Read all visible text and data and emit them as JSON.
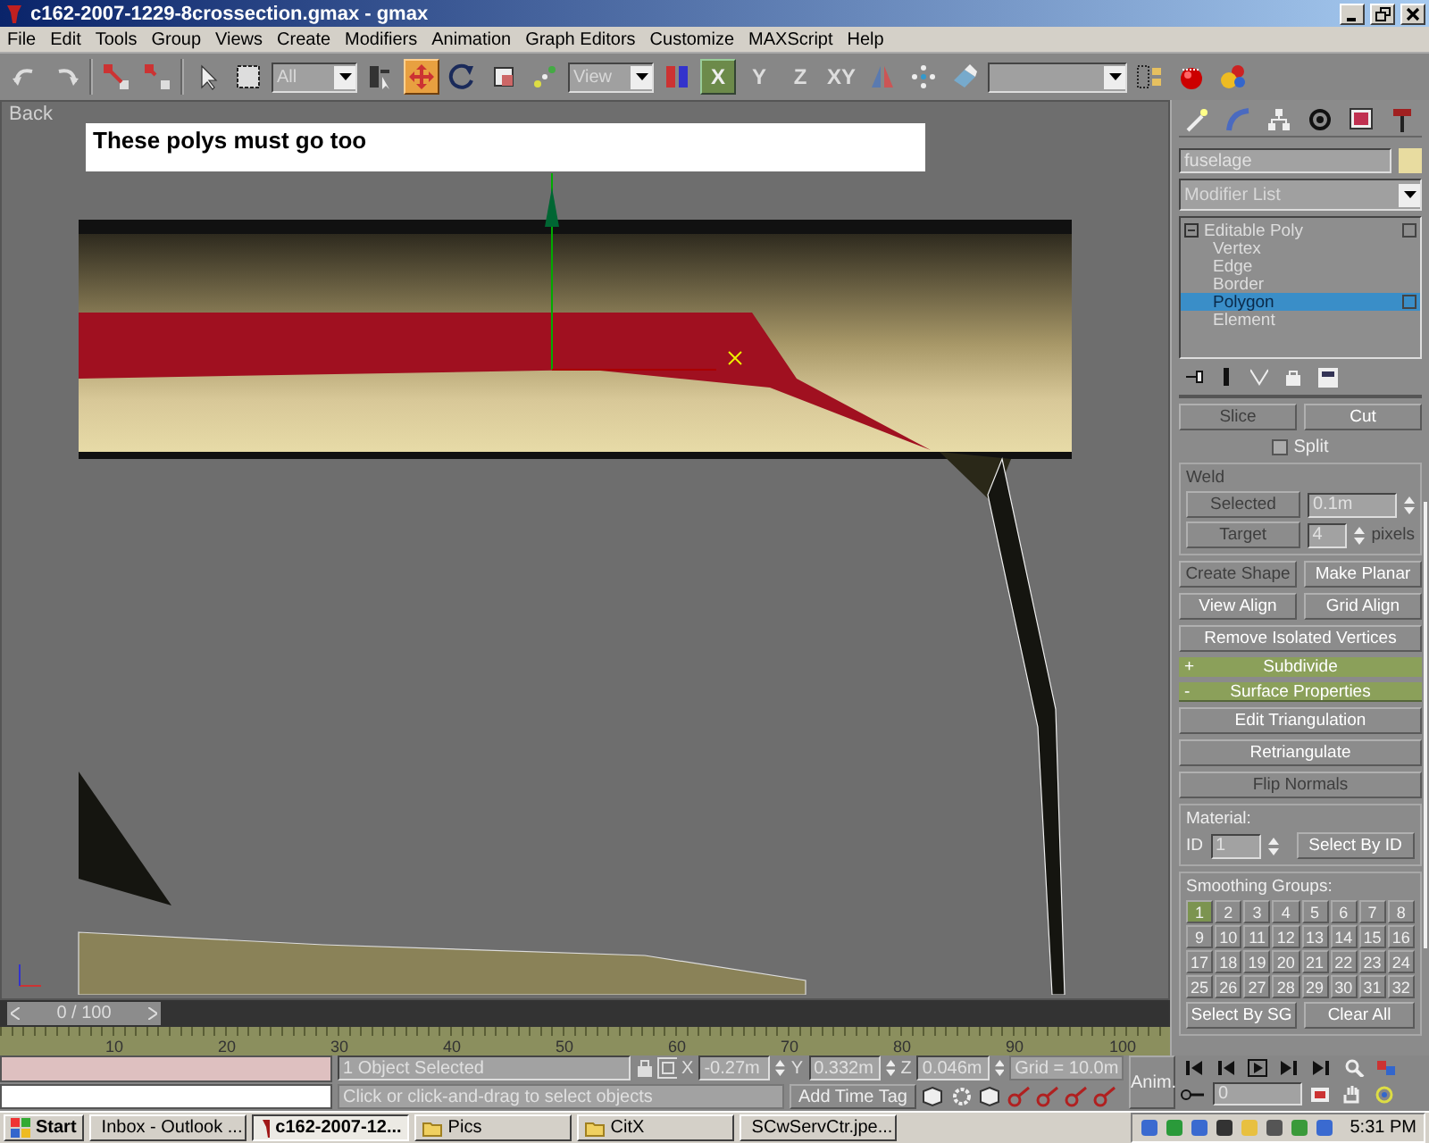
{
  "window": {
    "title": "c162-2007-1229-8crossection.gmax - gmax"
  },
  "menu": [
    "File",
    "Edit",
    "Tools",
    "Group",
    "Views",
    "Create",
    "Modifiers",
    "Animation",
    "Graph Editors",
    "Customize",
    "MAXScript",
    "Help"
  ],
  "toolbar": [
    {
      "kind": "undo",
      "selected": false
    },
    {
      "kind": "redo",
      "selected": false
    },
    {
      "kind": "sep"
    },
    {
      "kind": "link",
      "selected": false
    },
    {
      "kind": "unlink",
      "selected": false
    },
    {
      "kind": "sep"
    },
    {
      "kind": "pointer",
      "selected": false
    },
    {
      "kind": "region",
      "selected": false
    },
    {
      "kind": "dropdown",
      "value": "All"
    },
    {
      "kind": "list",
      "selected": false
    },
    {
      "kind": "move",
      "selected": true
    },
    {
      "kind": "rotate",
      "selected": false
    },
    {
      "kind": "scale",
      "selected": false
    },
    {
      "kind": "manipulate",
      "selected": false
    },
    {
      "kind": "dropdown",
      "value": "View"
    },
    {
      "kind": "pivot",
      "selected": false
    },
    {
      "kind": "axis",
      "label": "X",
      "selected": true
    },
    {
      "kind": "axis",
      "label": "Y",
      "selected": false
    },
    {
      "kind": "axis",
      "label": "Z",
      "selected": false
    },
    {
      "kind": "axis",
      "label": "XY",
      "selected": false
    },
    {
      "kind": "mirror",
      "selected": false
    },
    {
      "kind": "array",
      "selected": false
    },
    {
      "kind": "eraser",
      "selected": false
    },
    {
      "kind": "dropdown"
    },
    {
      "kind": "align",
      "selected": false
    },
    {
      "kind": "teapot",
      "selected": false
    },
    {
      "kind": "spheres",
      "selected": false
    }
  ],
  "viewport": {
    "label": "Back",
    "note": "These polys must go too"
  },
  "command_panel": {
    "object_name": "fuselage",
    "modifier_list": {
      "value": "Modifier List"
    },
    "stack": [
      {
        "label": "Editable Poly",
        "expanded": true,
        "children": [
          {
            "label": "Vertex",
            "selected": false
          },
          {
            "label": "Edge",
            "selected": false
          },
          {
            "label": "Border",
            "selected": false
          },
          {
            "label": "Polygon",
            "selected": true
          },
          {
            "label": "Element",
            "selected": false
          }
        ]
      }
    ],
    "top_buttons": [
      {
        "label": "Slice",
        "disabled": true
      },
      {
        "label": "Cut",
        "disabled": false
      }
    ],
    "split": {
      "label": "Split",
      "checked": false
    },
    "weld": {
      "title": "Weld",
      "disabled": true,
      "selected_button": {
        "label": "Selected",
        "disabled": true
      },
      "threshold": "0.1m",
      "target_button": {
        "label": "Target",
        "disabled": true
      },
      "pixels_value": "4",
      "pixels_label": "pixels"
    },
    "button_rows": [
      [
        {
          "label": "Create Shape",
          "disabled": true
        },
        {
          "label": "Make Planar",
          "disabled": false
        }
      ],
      [
        {
          "label": "View Align",
          "disabled": false
        },
        {
          "label": "Grid Align",
          "disabled": false
        }
      ],
      [
        {
          "label": "Remove Isolated Vertices",
          "disabled": false
        }
      ]
    ],
    "rollouts": [
      {
        "sign": "+",
        "title": "Subdivide",
        "expanded": false
      },
      {
        "sign": "-",
        "title": "Surface Properties",
        "expanded": true
      }
    ],
    "surface_buttons": [
      {
        "label": "Edit Triangulation",
        "disabled": false
      },
      {
        "label": "Retriangulate",
        "disabled": false
      },
      {
        "label": "Flip Normals",
        "disabled": true
      }
    ],
    "material": {
      "title": "Material:",
      "id_label": "ID",
      "id_value": "1",
      "button": "Select By ID"
    },
    "smoothing": {
      "title": "Smoothing Groups:",
      "groups": [
        {
          "label": "1",
          "selected": true
        },
        {
          "label": "2",
          "selected": false
        },
        {
          "label": "3",
          "selected": false
        },
        {
          "label": "4",
          "selected": false
        },
        {
          "label": "5",
          "selected": false
        },
        {
          "label": "6",
          "selected": false
        },
        {
          "label": "7",
          "selected": false
        },
        {
          "label": "8",
          "selected": false
        },
        {
          "label": "9",
          "selected": false
        },
        {
          "label": "10",
          "selected": false
        },
        {
          "label": "11",
          "selected": false
        },
        {
          "label": "12",
          "selected": false
        },
        {
          "label": "13",
          "selected": false
        },
        {
          "label": "14",
          "selected": false
        },
        {
          "label": "15",
          "selected": false
        },
        {
          "label": "16",
          "selected": false
        },
        {
          "label": "17",
          "selected": false
        },
        {
          "label": "18",
          "selected": false
        },
        {
          "label": "19",
          "selected": false
        },
        {
          "label": "20",
          "selected": false
        },
        {
          "label": "21",
          "selected": false
        },
        {
          "label": "22",
          "selected": false
        },
        {
          "label": "23",
          "selected": false
        },
        {
          "label": "24",
          "selected": false
        },
        {
          "label": "25",
          "selected": false
        },
        {
          "label": "26",
          "selected": false
        },
        {
          "label": "27",
          "selected": false
        },
        {
          "label": "28",
          "selected": false
        },
        {
          "label": "29",
          "selected": false
        },
        {
          "label": "30",
          "selected": false
        },
        {
          "label": "31",
          "selected": false
        },
        {
          "label": "32",
          "selected": false
        }
      ],
      "buttons": [
        "Select By SG",
        "Clear All"
      ]
    }
  },
  "timeline": {
    "frame": "0 / 100",
    "level": 0,
    "ruler": [
      "10",
      "20",
      "30",
      "40",
      "50",
      "60",
      "70",
      "80",
      "90",
      "100"
    ]
  },
  "status": {
    "selection": "1 Object Selected",
    "prompt": "Click or click-and-drag to select objects",
    "coords": [
      {
        "axis": "X",
        "value": "-0.27m"
      },
      {
        "axis": "Y",
        "value": "0.332m"
      },
      {
        "axis": "Z",
        "value": "0.046m"
      }
    ],
    "grid": "Grid = 10.0m",
    "time_tag": "Add Time Tag",
    "anim": "Anim.",
    "frame_field": "0"
  },
  "taskbar": {
    "start": "Start",
    "tasks": [
      {
        "label": "Inbox - Outlook ...",
        "kind": "mail",
        "selected": false
      },
      {
        "label": "c162-2007-12...",
        "kind": "gmax",
        "selected": true
      },
      {
        "label": "Pics",
        "kind": "folder",
        "selected": false
      },
      {
        "label": "CitX",
        "kind": "folder",
        "selected": false
      },
      {
        "label": "SCwServCtr.jpe...",
        "kind": "image",
        "selected": false
      }
    ],
    "clock": "5:31 PM"
  }
}
